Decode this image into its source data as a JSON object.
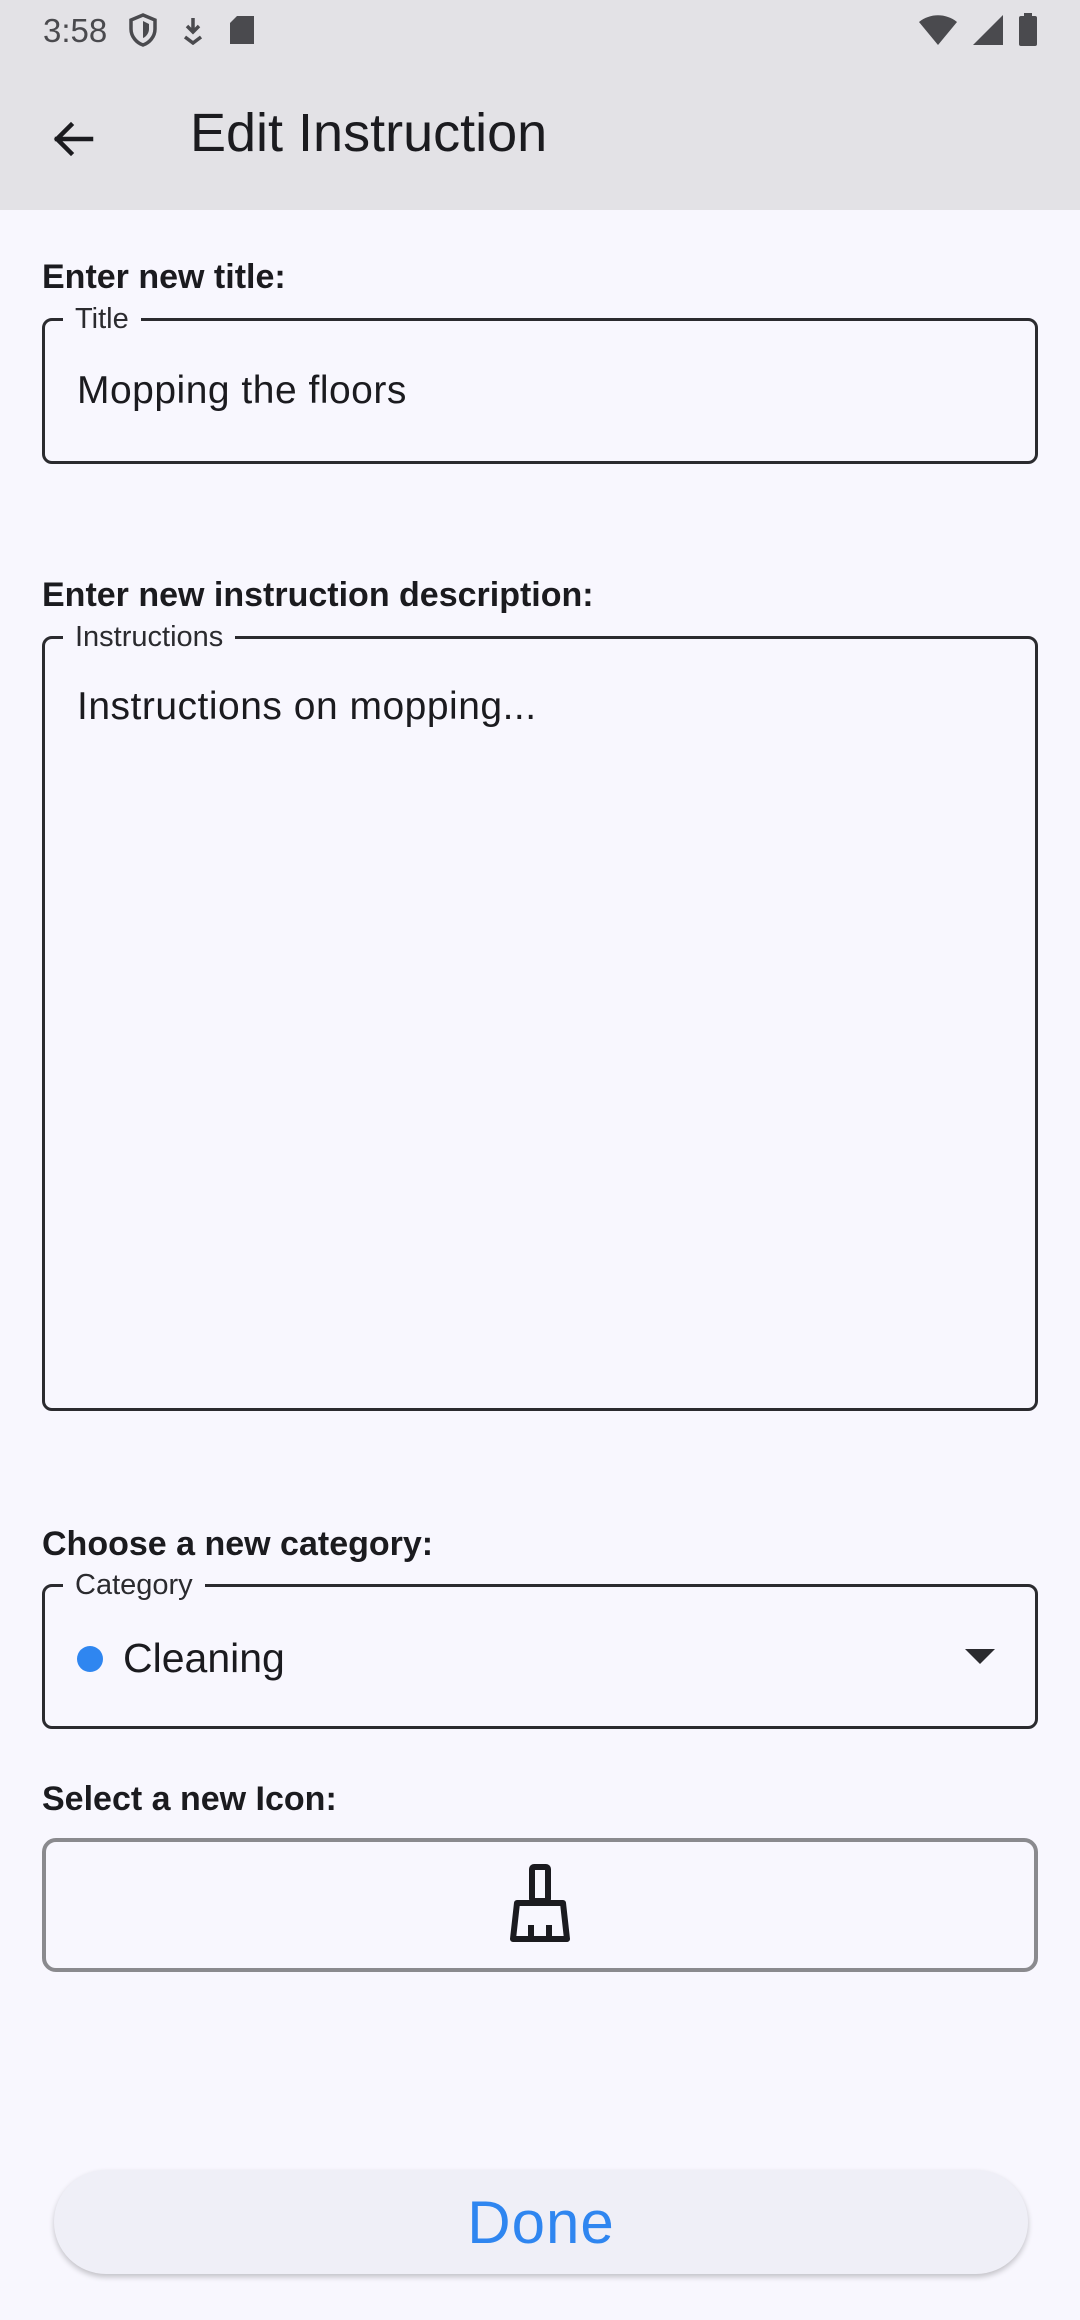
{
  "status_bar": {
    "time": "3:58",
    "left_icons": [
      "shield-icon",
      "download-icon",
      "sd-card-icon"
    ],
    "right_icons": [
      "wifi-icon",
      "signal-icon",
      "battery-icon"
    ]
  },
  "app_bar": {
    "back_icon": "arrow-back-icon",
    "title": "Edit Instruction"
  },
  "form": {
    "title_section": {
      "label": "Enter new title:",
      "field_label": "Title",
      "value": "Mopping the floors"
    },
    "description_section": {
      "label": "Enter new instruction description:",
      "field_label": "Instructions",
      "value": "Instructions on mopping..."
    },
    "category_section": {
      "label": "Choose a new category:",
      "field_label": "Category",
      "value": "Cleaning",
      "dot_color": "#2f86f0"
    },
    "icon_section": {
      "label": "Select a new Icon:",
      "selected_icon": "broom-icon"
    }
  },
  "done_button": {
    "label": "Done",
    "color": "#2f86f0"
  }
}
